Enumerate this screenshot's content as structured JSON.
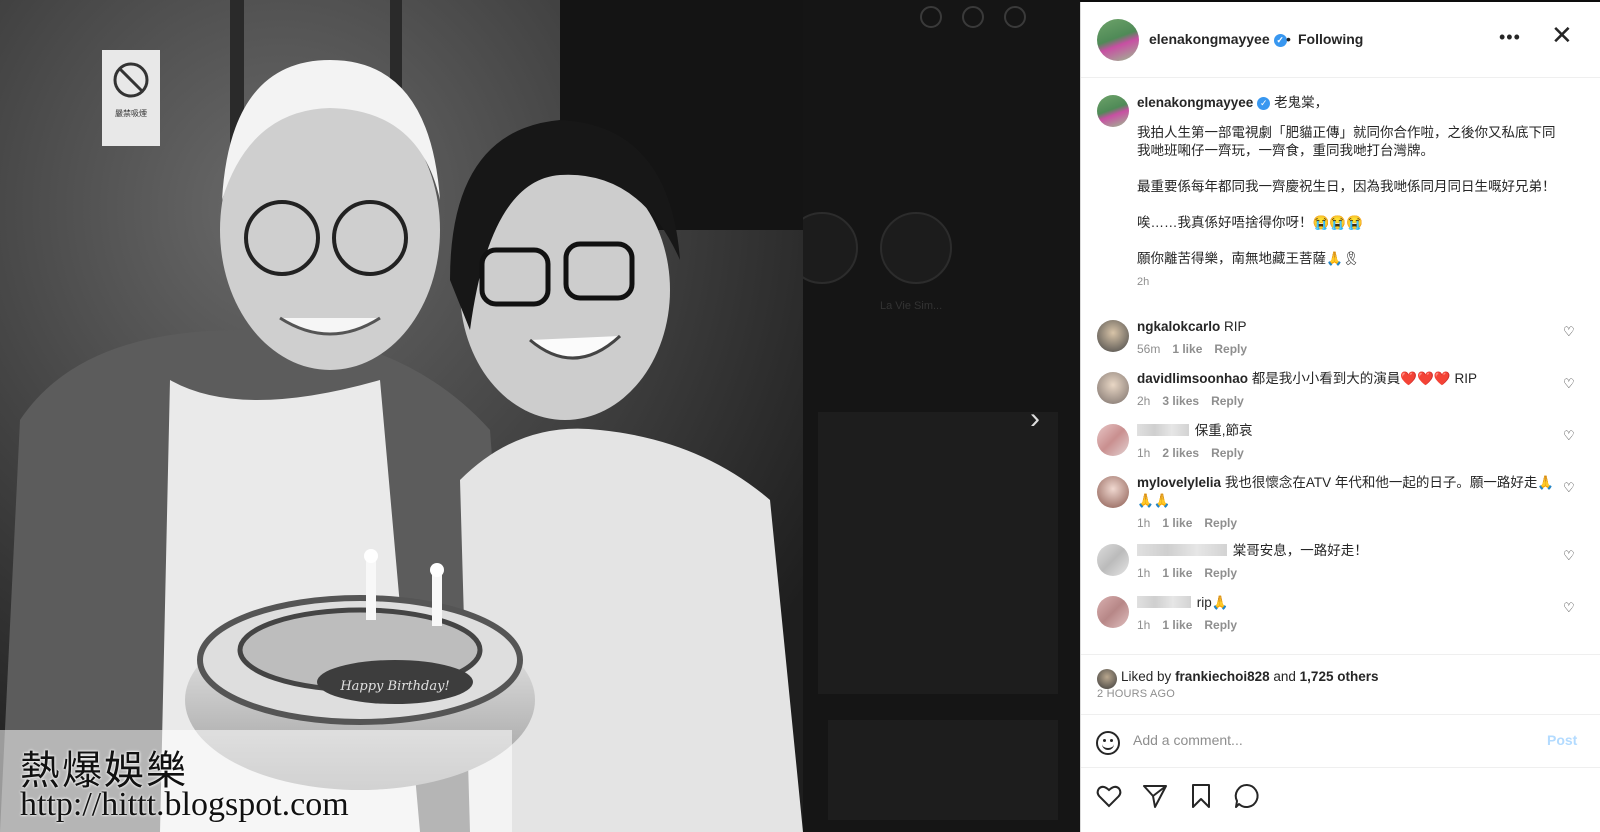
{
  "photo": {
    "watermark_main": "熱爆娛樂",
    "watermark_url": "http://hittt.blogspot.com",
    "cake_text": "Happy Birthday!",
    "sign_text": "嚴禁吸煙"
  },
  "background_page": {
    "story_labels": [
      "La Vie Sim..."
    ]
  },
  "header": {
    "username": "elenakongmayyee",
    "separator": "•",
    "follow_status": "Following"
  },
  "caption": {
    "username": "elenakongmayyee",
    "greeting": "老鬼棠，",
    "paragraphs": [
      "我拍人生第一部電視劇「肥貓正傳」就同你合作啦，之後你又私底下同我哋班啝仔一齊玩，一齊食，重同我哋打台灣牌。",
      "最重要係每年都同我一齊慶祝生日，因為我哋係同月同日生嘅好兄弟！",
      "唉……我真係好唔捨得你呀！😭😭😭",
      "願你離苦得樂，南無地藏王菩薩🙏🎗"
    ],
    "time": "2h"
  },
  "comments": [
    {
      "username": "ngkalokcarlo",
      "text": "RIP",
      "time": "56m",
      "likes": "1 like",
      "reply": "Reply"
    },
    {
      "username": "davidlimsoonhao",
      "text": "都是我小小看到大的演員❤️❤️❤️ RIP",
      "time": "2h",
      "likes": "3 likes",
      "reply": "Reply"
    },
    {
      "username": "",
      "text": "保重,節哀",
      "time": "1h",
      "likes": "2 likes",
      "reply": "Reply"
    },
    {
      "username": "mylovelylelia",
      "text": "我也很懷念在ATV 年代和他一起的日子。願一路好走🙏🙏🙏",
      "time": "1h",
      "likes": "1 like",
      "reply": "Reply"
    },
    {
      "username": "",
      "text": "棠哥安息，一路好走！",
      "time": "1h",
      "likes": "1 like",
      "reply": "Reply"
    },
    {
      "username": "",
      "text": "rip🙏",
      "time": "1h",
      "likes": "1 like",
      "reply": "Reply"
    }
  ],
  "likes_summary": {
    "prefix": "Liked by",
    "user": "frankiechoi828",
    "conj": "and",
    "others": "1,725 others"
  },
  "post_age": "2 HOURS AGO",
  "add_comment": {
    "placeholder": "Add a comment...",
    "post_label": "Post"
  },
  "icons": {
    "verified": "verified-badge-icon",
    "more": "more-options-icon",
    "close": "close-icon",
    "like": "heart-icon",
    "share": "send-icon",
    "save": "bookmark-icon",
    "comment": "comment-bubble-icon",
    "emoji": "emoji-icon",
    "next": "chevron-right-icon"
  },
  "colors": {
    "verified_blue": "#3897f0",
    "text_primary": "#262626",
    "text_secondary": "#8e8e8e",
    "post_disabled": "#b3dbff",
    "heart_red": "#ed4956"
  }
}
